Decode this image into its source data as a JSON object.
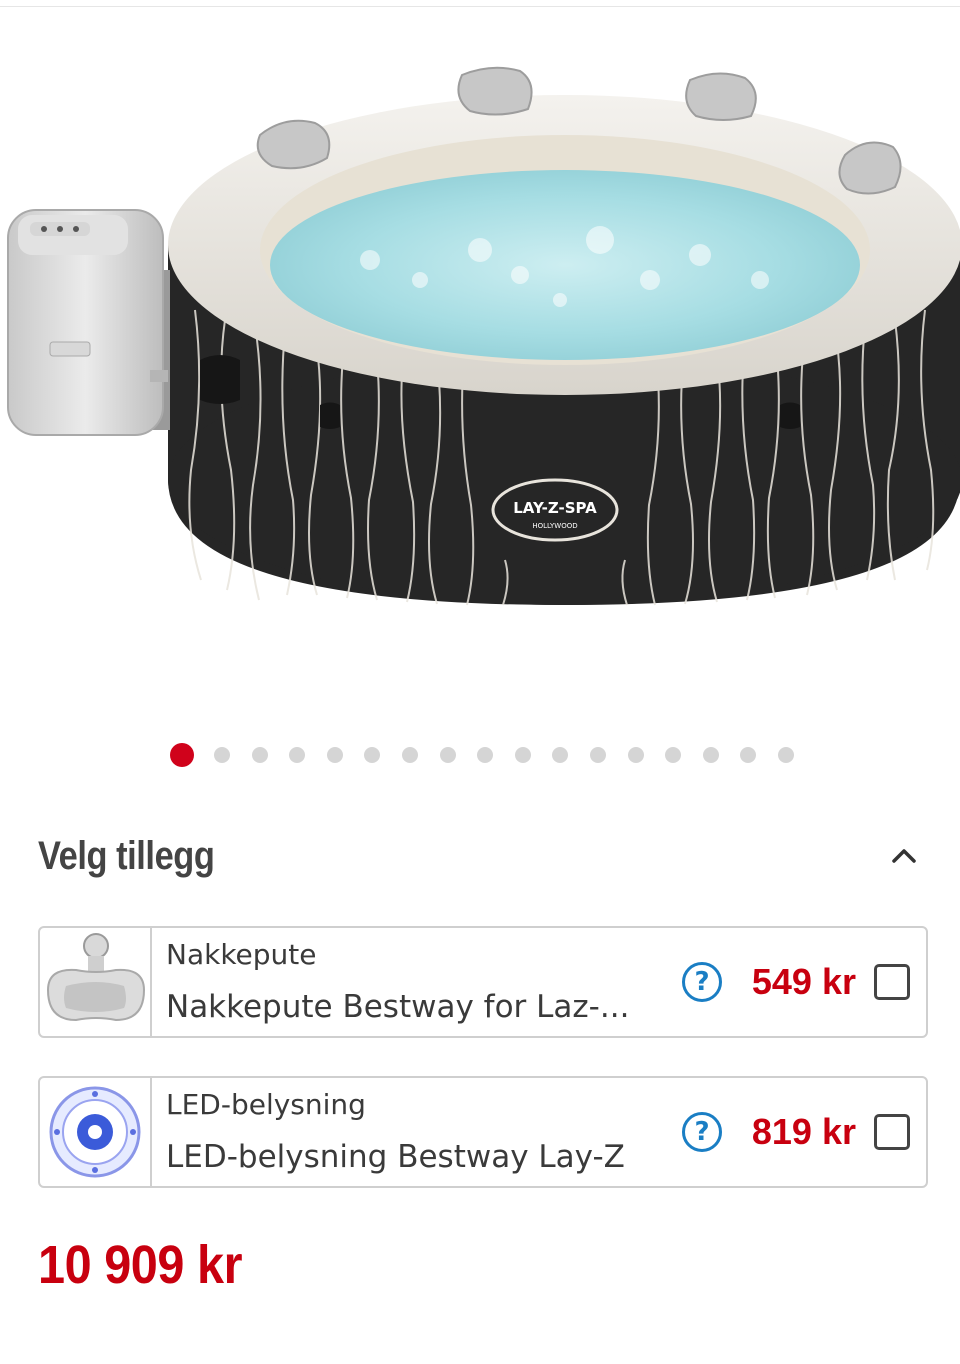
{
  "gallery": {
    "image_alt": "Lay-Z-Spa Hollywood boblebad",
    "logo_brand": "LAY-Z-SPA",
    "logo_model": "HOLLYWOOD",
    "slide_count": 17,
    "active_index": 0
  },
  "addons": {
    "title": "Velg tillegg",
    "items": [
      {
        "category": "Nakkepute",
        "name": "Nakkepute Bestway for Laz-...",
        "price": "549 kr",
        "help": "?"
      },
      {
        "category": "LED-belysning",
        "name": "LED-belysning Bestway Lay-Z",
        "price": "819 kr",
        "help": "?"
      }
    ]
  },
  "total": {
    "price": "10 909 kr"
  },
  "colors": {
    "accent": "#c8000f",
    "dot_active": "#d0021b",
    "dot": "#d5d5d5",
    "help": "#1a7ec4"
  }
}
